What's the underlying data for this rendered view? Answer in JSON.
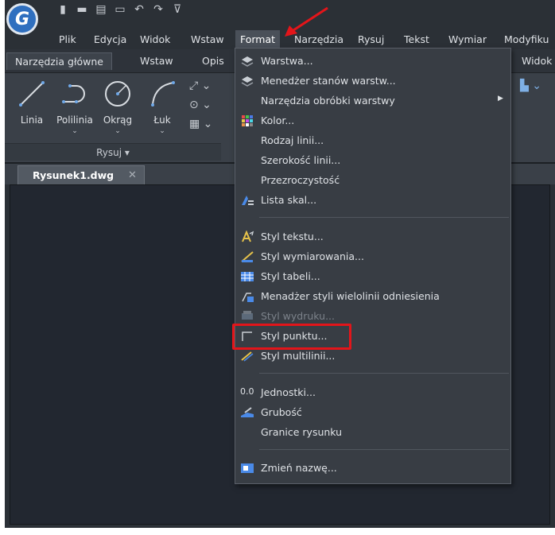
{
  "app": {
    "logo_letter": "G"
  },
  "quick_access": [
    "new-file-icon",
    "open-folder-icon",
    "print-icon",
    "save-icon",
    "undo-icon",
    "redo-icon",
    "customize-icon"
  ],
  "menubar": {
    "items": [
      "Plik",
      "Edycja",
      "Widok",
      "Wstaw",
      "Format",
      "Narzędzia",
      "Rysuj",
      "Tekst",
      "Wymiar",
      "Modyfiku"
    ],
    "active": "Format"
  },
  "ribbon_tabs": {
    "items": [
      "Narzędzia główne",
      "Wstaw",
      "Opis"
    ],
    "right_item": "Widok"
  },
  "ribbon": {
    "tools": [
      {
        "label": "Linia",
        "has_caret": false
      },
      {
        "label": "Polilinia",
        "has_caret": true
      },
      {
        "label": "Okrąg",
        "has_caret": true
      },
      {
        "label": "Łuk",
        "has_caret": true
      }
    ],
    "panel_label": "Rysuj",
    "panel_caret": "▾"
  },
  "document_tab": {
    "label": "Rysunek1.dwg",
    "close": "✕"
  },
  "format_menu": {
    "items": [
      {
        "label": "Warstwa...",
        "icon": "layer-icon",
        "disabled": false
      },
      {
        "label": "Menedżer stanów warstw...",
        "icon": "layer-states-icon",
        "disabled": false
      },
      {
        "label": "Narzędzia obróbki warstwy",
        "icon": "",
        "disabled": false,
        "submenu": true
      },
      {
        "label": "Kolor...",
        "icon": "color-icon",
        "disabled": false
      },
      {
        "label": "Rodzaj linii...",
        "icon": "",
        "disabled": false
      },
      {
        "label": "Szerokość linii...",
        "icon": "",
        "disabled": false
      },
      {
        "label": "Przezroczystość",
        "icon": "",
        "disabled": false
      },
      {
        "label": "Lista skal...",
        "icon": "scale-list-icon",
        "disabled": false
      },
      {
        "label": "Styl tekstu...",
        "icon": "text-style-icon",
        "disabled": false
      },
      {
        "label": "Styl wymiarowania...",
        "icon": "dimension-style-icon",
        "disabled": false
      },
      {
        "label": "Styl tabeli...",
        "icon": "table-style-icon",
        "disabled": false
      },
      {
        "label": "Menadżer styli wielolinii odniesienia",
        "icon": "multileader-style-icon",
        "disabled": false
      },
      {
        "label": "Styl wydruku...",
        "icon": "plot-style-icon",
        "disabled": true
      },
      {
        "label": "Styl punktu...",
        "icon": "point-style-icon",
        "disabled": false,
        "highlighted": true
      },
      {
        "label": "Styl multilinii...",
        "icon": "multiline-style-icon",
        "disabled": false
      },
      {
        "label": "Jednostki...",
        "icon": "units-icon",
        "icon_text": "0.0",
        "disabled": false
      },
      {
        "label": "Grubość",
        "icon": "thickness-icon",
        "disabled": false
      },
      {
        "label": "Granice rysunku",
        "icon": "",
        "disabled": false
      },
      {
        "label": "Zmień nazwę...",
        "icon": "rename-icon",
        "disabled": false
      }
    ]
  },
  "colors": {
    "annotation": "#e3151a",
    "accent": "#2f6fbf"
  }
}
